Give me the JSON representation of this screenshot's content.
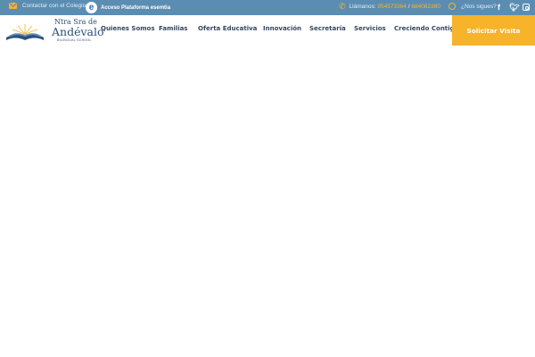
{
  "topbar": {
    "contact_label": "Contactar con el Colegio",
    "platform_label": "Acceso Plataforma esemtia",
    "phone_prefix": "Llámanos:",
    "phone_1": "954573364",
    "phone_sep": "/",
    "phone_2": "684082380",
    "follow_label": "¿Nos sigues?",
    "icons": [
      "envelope-icon",
      "esemtia-logo-icon",
      "phone-icon",
      "globe-icon",
      "facebook-icon",
      "twitter-icon",
      "instagram-icon"
    ],
    "colors": {
      "bar": "#5b8db3",
      "accent": "#f7b329"
    }
  },
  "logo": {
    "line1": "Ntra Sra de",
    "line2": "Andévalo",
    "line3": "BILINGUAL SCHOOL"
  },
  "nav": {
    "items": [
      "Quienes Somos",
      "Familias",
      "Oferta Educativa",
      "Innovación",
      "Secretaría",
      "Servicios",
      "Creciendo Contigo"
    ],
    "cta": "Solicitar Visita"
  }
}
